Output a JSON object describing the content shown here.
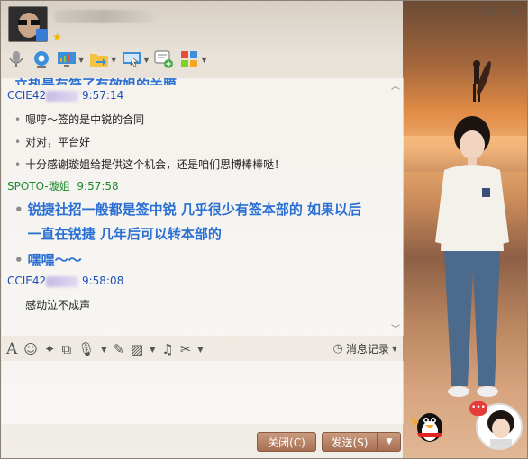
{
  "window": {
    "minimize_label": "—",
    "maximize_label": "☐",
    "close_label": "✕",
    "collapse_label": "⌄"
  },
  "toolbar": {
    "icons": [
      "microphone-icon",
      "webcam-icon",
      "screen-share-icon",
      "send-file-icon",
      "remote-desktop-icon",
      "create-discussion-icon",
      "apps-icon"
    ]
  },
  "chat": {
    "partial_top_text": "立热是有符了有效姐的关膜",
    "messages": [
      {
        "sender_prefix": "CCIE42",
        "time": "9:57:14",
        "lines": [
          "嗯哼～签的是中锐的合同",
          "对对，平台好",
          "十分感谢璇姐给提供这个机会，还是咱们思博棒棒哒！"
        ]
      },
      {
        "sender_prefix": "SPOTO-璇姐",
        "time": "9:57:58",
        "lines": [
          "锐捷社招一般都是签中锐 几乎很少有签本部的 如果以后",
          "一直在锐捷 几年后可以转本部的",
          "嘿嘿～～"
        ]
      },
      {
        "sender_prefix": "CCIE42",
        "time": "9:58:08",
        "lines": [
          "感动泣不成声"
        ]
      }
    ]
  },
  "input_toolbar": {
    "history_label": "消息记录"
  },
  "buttons": {
    "close_label": "关闭(C)",
    "send_label": "发送(S)"
  },
  "notification_count": "•••",
  "colors": {
    "blue_name": "#1f4fb8",
    "green_name": "#1f8a2e",
    "big_text": "#2a6fd4",
    "button": "#a86e52"
  }
}
